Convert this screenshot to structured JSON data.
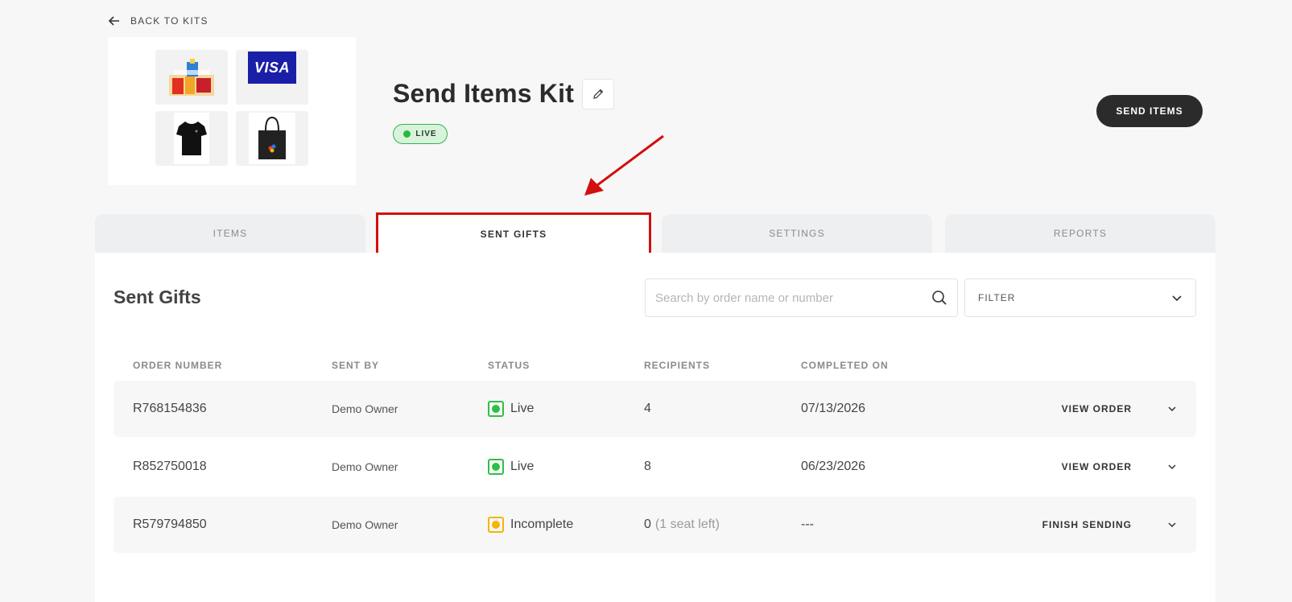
{
  "back_link": {
    "label": "BACK TO KITS"
  },
  "kit": {
    "title": "Send Items Kit",
    "status": "LIVE",
    "thumbnails": [
      {
        "name": "snacks"
      },
      {
        "name": "visa-card",
        "text": "VISA"
      },
      {
        "name": "black-tshirt"
      },
      {
        "name": "tote-bag"
      }
    ]
  },
  "header": {
    "send_items_label": "SEND ITEMS"
  },
  "tabs": [
    {
      "label": "ITEMS",
      "active": false
    },
    {
      "label": "SENT GIFTS",
      "active": true
    },
    {
      "label": "SETTINGS",
      "active": false
    },
    {
      "label": "REPORTS",
      "active": false
    }
  ],
  "section": {
    "title": "Sent Gifts",
    "search": {
      "placeholder": "Search by order name or number",
      "value": ""
    },
    "filter": {
      "label": "FILTER"
    }
  },
  "table": {
    "columns": [
      "ORDER NUMBER",
      "SENT BY",
      "STATUS",
      "RECIPIENTS",
      "COMPLETED ON"
    ],
    "rows": [
      {
        "order_number": "R768154836",
        "sent_by": "Demo Owner",
        "status": "Live",
        "recipients": "4",
        "seat_note": "",
        "completed_on": "07/13/2026",
        "action": "VIEW ORDER"
      },
      {
        "order_number": "R852750018",
        "sent_by": "Demo Owner",
        "status": "Live",
        "recipients": "8",
        "seat_note": "",
        "completed_on": "06/23/2026",
        "action": "VIEW ORDER"
      },
      {
        "order_number": "R579794850",
        "sent_by": "Demo Owner",
        "status": "Incomplete",
        "recipients": "0",
        "seat_note": "(1 seat left)",
        "completed_on": "---",
        "action": "FINISH SENDING"
      }
    ]
  },
  "colors": {
    "highlight": "#d20f0f",
    "live": "#2fbf45",
    "incomplete": "#f5b400",
    "primary_button": "#2b2b2b"
  }
}
